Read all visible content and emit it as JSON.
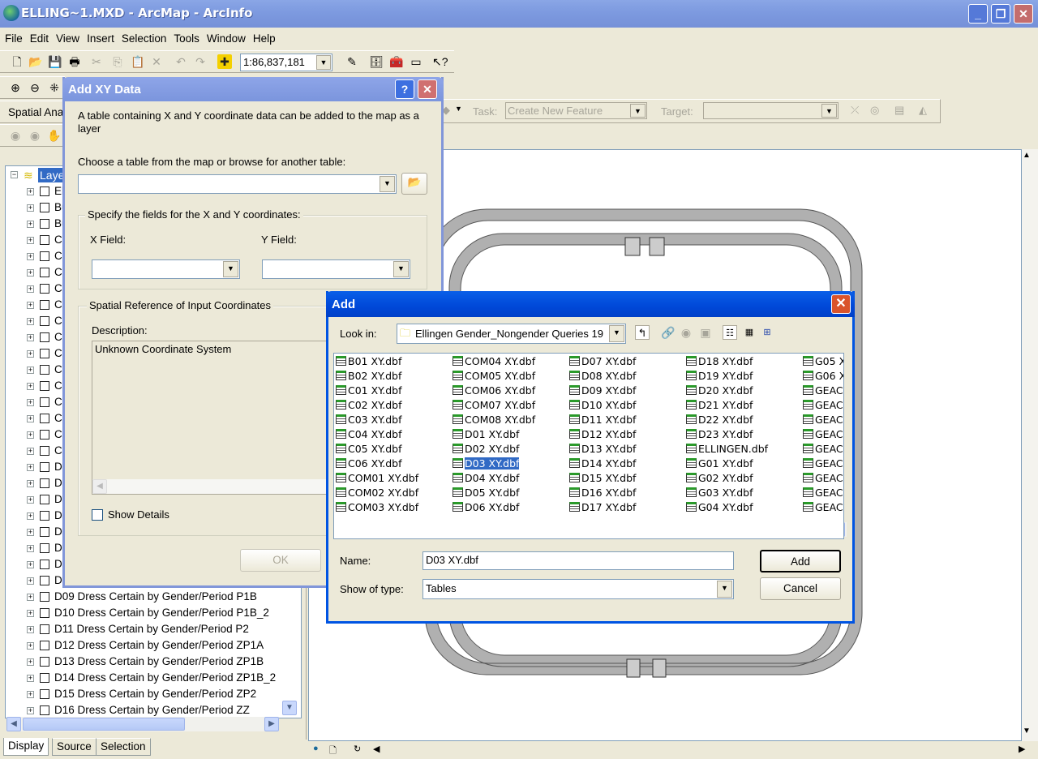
{
  "app": {
    "title": "ELLING~1.MXD - ArcMap - ArcInfo",
    "window_buttons": {
      "minimize": "_",
      "restore": "❐",
      "close": "✕"
    }
  },
  "menu": [
    "File",
    "Edit",
    "View",
    "Insert",
    "Selection",
    "Tools",
    "Window",
    "Help"
  ],
  "toolbar": {
    "scale": "1:86,837,181",
    "spatial_analyst_label": "Spatial Ana",
    "task_label": "Task:",
    "task_value": "Create New Feature",
    "target_label": "Target:",
    "target_value": ""
  },
  "toc": {
    "root_label": "Laye",
    "rows_truncated": [
      "El",
      "Bu",
      "Bu",
      "C",
      "C",
      "C",
      "C",
      "C",
      "C",
      "C",
      "C",
      "C",
      "C",
      "C",
      "C",
      "C",
      "C",
      "D",
      "D",
      "D",
      "D",
      "D",
      "D",
      "D",
      "D"
    ],
    "rows_full": [
      "D09 Dress Certain by Gender/Period P1B",
      "D10 Dress Certain by Gender/Period P1B_2",
      "D11 Dress Certain by Gender/Period P2",
      "D12 Dress Certain by Gender/Period ZP1A",
      "D13 Dress Certain by Gender/Period ZP1B",
      "D14 Dress Certain by Gender/Period ZP1B_2",
      "D15 Dress Certain by Gender/Period ZP2",
      "D16 Dress Certain by Gender/Period ZZ"
    ],
    "tabs": [
      "Display",
      "Source",
      "Selection"
    ]
  },
  "xy_dialog": {
    "title": "Add XY Data",
    "help": "?",
    "close": "✕",
    "intro": "A table containing X and Y coordinate data can be added to the map as a layer",
    "choose_label": "Choose a table from the map or browse for another table:",
    "table_value": "",
    "fields_group": "Specify the fields for the X and Y coordinates:",
    "x_field_label": "X Field:",
    "y_field_label": "Y Field:",
    "x_field_value": "",
    "y_field_value": "",
    "spatial_group": "Spatial Reference of Input Coordinates",
    "description_label": "Description:",
    "description_value": "Unknown Coordinate System",
    "show_details": "Show Details",
    "ok": "OK"
  },
  "add_dialog": {
    "title": "Add",
    "look_in_label": "Look in:",
    "look_in_value": "Ellingen Gender_Nongender Queries 19",
    "files": [
      [
        "B01 XY.dbf",
        "B02 XY.dbf",
        "C01 XY.dbf",
        "C02 XY.dbf",
        "C03 XY.dbf",
        "C04 XY.dbf",
        "C05 XY.dbf",
        "C06 XY.dbf",
        "COM01 XY.dbf",
        "COM02 XY.dbf",
        "COM03 XY.dbf"
      ],
      [
        "COM04 XY.dbf",
        "COM05 XY.dbf",
        "COM06 XY.dbf",
        "COM07 XY.dbf",
        "COM08 XY.dbf",
        "D01 XY.dbf",
        "D02 XY.dbf",
        "D03 XY.dbf",
        "D04 XY.dbf",
        "D05 XY.dbf",
        "D06 XY.dbf"
      ],
      [
        "D07 XY.dbf",
        "D08 XY.dbf",
        "D09 XY.dbf",
        "D10 XY.dbf",
        "D11 XY.dbf",
        "D12 XY.dbf",
        "D13 XY.dbf",
        "D14 XY.dbf",
        "D15 XY.dbf",
        "D16 XY.dbf",
        "D17 XY.dbf"
      ],
      [
        "D18 XY.dbf",
        "D19 XY.dbf",
        "D20 XY.dbf",
        "D21 XY.dbf",
        "D22 XY.dbf",
        "D23 XY.dbf",
        "ELLINGEN.dbf",
        "G01 XY.dbf",
        "G02 XY.dbf",
        "G03 XY.dbf",
        "G04 XY.dbf"
      ],
      [
        "G05 X",
        "G06 X",
        "GEAC",
        "GEAC",
        "GEAC",
        "GEAC",
        "GEAC",
        "GEAC",
        "GEAC",
        "GEAC",
        "GEAC"
      ]
    ],
    "selected_file": "D03 XY.dbf",
    "name_label": "Name:",
    "name_value": "D03 XY.dbf",
    "type_label": "Show of type:",
    "type_value": "Tables",
    "add_button": "Add",
    "cancel_button": "Cancel"
  }
}
